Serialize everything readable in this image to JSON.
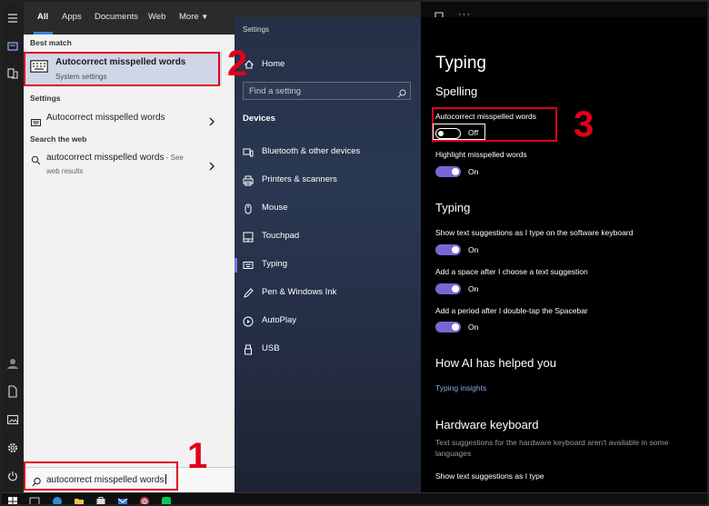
{
  "search": {
    "tabs": {
      "all": "All",
      "apps": "Apps",
      "documents": "Documents",
      "web": "Web",
      "more": "More"
    },
    "best_match_header": "Best match",
    "best_match": {
      "title": "Autocorrect misspelled words",
      "subtitle": "System settings"
    },
    "settings_header": "Settings",
    "settings_result": "Autocorrect misspelled words",
    "web_header": "Search the web",
    "web_result": {
      "main": "autocorrect misspelled words",
      "suffix": " - See",
      "line2": "web results"
    },
    "query": "autocorrect misspelled words"
  },
  "settings_nav": {
    "title": "Settings",
    "home": "Home",
    "find_placeholder": "Find a setting",
    "section": "Devices",
    "items": [
      {
        "label": "Bluetooth & other devices",
        "icon": "bluetooth-icon"
      },
      {
        "label": "Printers & scanners",
        "icon": "printer-icon"
      },
      {
        "label": "Mouse",
        "icon": "mouse-icon"
      },
      {
        "label": "Touchpad",
        "icon": "touchpad-icon"
      },
      {
        "label": "Typing",
        "icon": "keyboard-icon",
        "selected": true
      },
      {
        "label": "Pen & Windows Ink",
        "icon": "pen-icon"
      },
      {
        "label": "AutoPlay",
        "icon": "autoplay-icon"
      },
      {
        "label": "USB",
        "icon": "usb-icon"
      }
    ]
  },
  "typing": {
    "title": "Typing",
    "spelling_header": "Spelling",
    "autocorrect_label": "Autocorrect misspelled words",
    "autocorrect_state": "Off",
    "highlight_label": "Highlight misspelled words",
    "highlight_state": "On",
    "typing_header": "Typing",
    "suggest_label": "Show text suggestions as I type on the software keyboard",
    "suggest_state": "On",
    "space_label": "Add a space after I choose a text suggestion",
    "space_state": "On",
    "period_label": "Add a period after I double-tap the Spacebar",
    "period_state": "On",
    "ai_header": "How AI has helped you",
    "insights_link": "Typing insights",
    "hw_header": "Hardware keyboard",
    "hw_note": "Text suggestions for the hardware keyboard aren't available in some languages",
    "hw_suggest_label": "Show text suggestions as I type"
  },
  "annotations": {
    "one": "1",
    "two": "2",
    "three": "3"
  },
  "colors": {
    "accent": "#7667d6",
    "annotation": "#e2001a",
    "link": "#8aa8e8"
  },
  "icons": [
    "hamburger-icon",
    "search-icon",
    "settings-gear-icon",
    "power-icon",
    "document-icon",
    "image-icon",
    "home-icon",
    "chevron-right-icon",
    "keyboard-icon",
    "globe-search-icon",
    "feedback-icon",
    "more-icon",
    "windows-start-icon"
  ]
}
